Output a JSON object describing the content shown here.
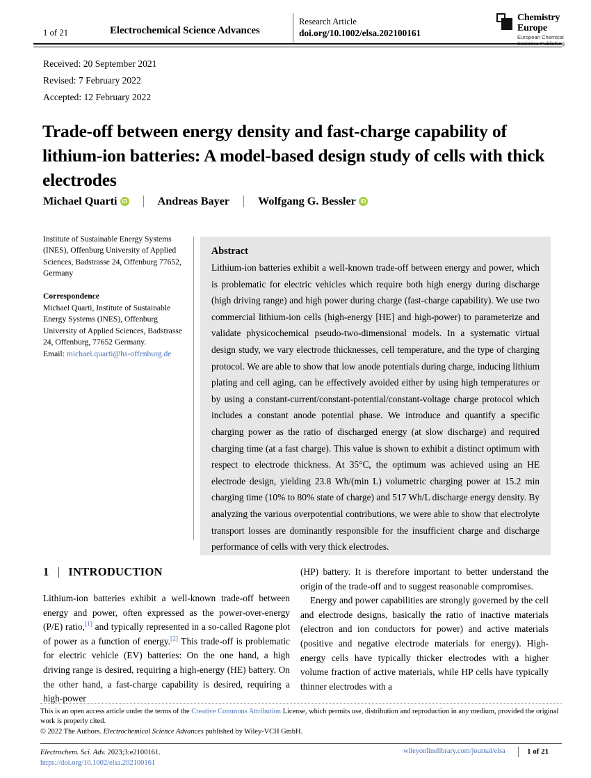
{
  "running_head": {
    "page_number": "1 of 21",
    "journal": "Electrochemical Science Advances",
    "article_type": "Research Article",
    "doi": "doi.org/10.1002/elsa.202100161",
    "logo": {
      "name_line1": "Chemistry",
      "name_line2": "Europe",
      "sub_line1": "European Chemical",
      "sub_line2": "Societies Publishing"
    }
  },
  "dates": {
    "received": "Received: 20 September 2021",
    "revised": "Revised: 7 February 2022",
    "accepted": "Accepted: 12 February 2022"
  },
  "title": "Trade-off between energy density and fast-charge capability of lithium-ion batteries: A model-based design study of cells with thick electrodes",
  "authors": [
    {
      "name": "Michael Quarti",
      "orcid": true
    },
    {
      "name": "Andreas Bayer",
      "orcid": false
    },
    {
      "name": "Wolfgang G. Bessler",
      "orcid": true
    }
  ],
  "affiliation": "Institute of Sustainable Energy Systems (INES), Offenburg University of Applied Sciences, Badstrasse 24, Offenburg 77652, Germany",
  "correspondence": {
    "heading": "Correspondence",
    "text": "Michael Quarti, Institute of Sustainable Energy Systems (INES), Offenburg University of Applied Sciences, Badstrasse 24, Offenburg, 77652 Germany.",
    "email_label": "Email:",
    "email": "michael.quarti@hs-offenburg.de"
  },
  "abstract": {
    "heading": "Abstract",
    "text": "Lithium-ion batteries exhibit a well-known trade-off between energy and power, which is problematic for electric vehicles which require both high energy during discharge (high driving range) and high power during charge (fast-charge capability). We use two commercial lithium-ion cells (high-energy [HE] and high-power) to parameterize and validate physicochemical pseudo-two-dimensional models. In a systematic virtual design study, we vary electrode thicknesses, cell temperature, and the type of charging protocol. We are able to show that low anode potentials during charge, inducing lithium plating and cell aging, can be effectively avoided either by using high temperatures or by using a constant-current/constant-potential/constant-voltage charge protocol which includes a constant anode potential phase. We introduce and quantify a specific charging power as the ratio of discharged energy (at slow discharge) and required charging time (at a fast charge). This value is shown to exhibit a distinct optimum with respect to electrode thickness. At 35°C, the optimum was achieved using an HE electrode design, yielding 23.8 Wh/(min L) volumetric charging power at 15.2 min charging time (10% to 80% state of charge) and 517 Wh/L discharge energy density. By analyzing the various overpotential contributions, we were able to show that electrolyte transport losses are dominantly responsible for the insufficient charge and discharge performance of cells with very thick electrodes."
  },
  "section": {
    "number": "1",
    "title": "INTRODUCTION"
  },
  "body": {
    "left_col_part1": "Lithium-ion batteries exhibit a well-known trade-off between energy and power, often expressed as the power-over-energy (P/E) ratio,",
    "citation1": "[1]",
    "left_col_part2": " and typically represented in a so-called Ragone plot of power as a function of energy.",
    "citation2": "[2]",
    "left_col_part3": " This trade-off is problematic for electric vehicle (EV) batteries: On the one hand, a high driving range is desired, requiring a high-energy (HE) battery. On the other hand, a fast-charge capability is desired, requiring a high-power",
    "right_col_para1": "(HP) battery. It is therefore important to better understand the origin of the trade-off and to suggest reasonable compromises.",
    "right_col_para2": "Energy and power capabilities are strongly governed by the cell and electrode designs, basically the ratio of inactive materials (electron and ion conductors for power) and active materials (positive and negative electrode materials for energy). High-energy cells have typically thicker electrodes with a higher volume fraction of active materials, while HP cells have typically thinner electrodes with a"
  },
  "license": {
    "part1": "This is an open access article under the terms of the ",
    "link": "Creative Commons Attribution",
    "part2": " License, which permits use, distribution and reproduction in any medium, provided the original work is properly cited.",
    "copyright_part1": "© 2022 The Authors. ",
    "copyright_journal": "Electrochemical Science Advances",
    "copyright_part2": " published by Wiley-VCH GmbH."
  },
  "footer": {
    "citation_italic": "Electrochem. Sci. Adv.",
    "citation_rest": " 2023;3:e2100161.",
    "doi_url": "https://doi.org/10.1002/elsa.202100161",
    "journal_url": "wileyonlinelibrary.com/journal/elsa",
    "page_number": "1 of 21"
  },
  "colors": {
    "link": "#4a72b8",
    "orcid_green": "#a6ce39",
    "abstract_bg": "#e6e6e6"
  }
}
